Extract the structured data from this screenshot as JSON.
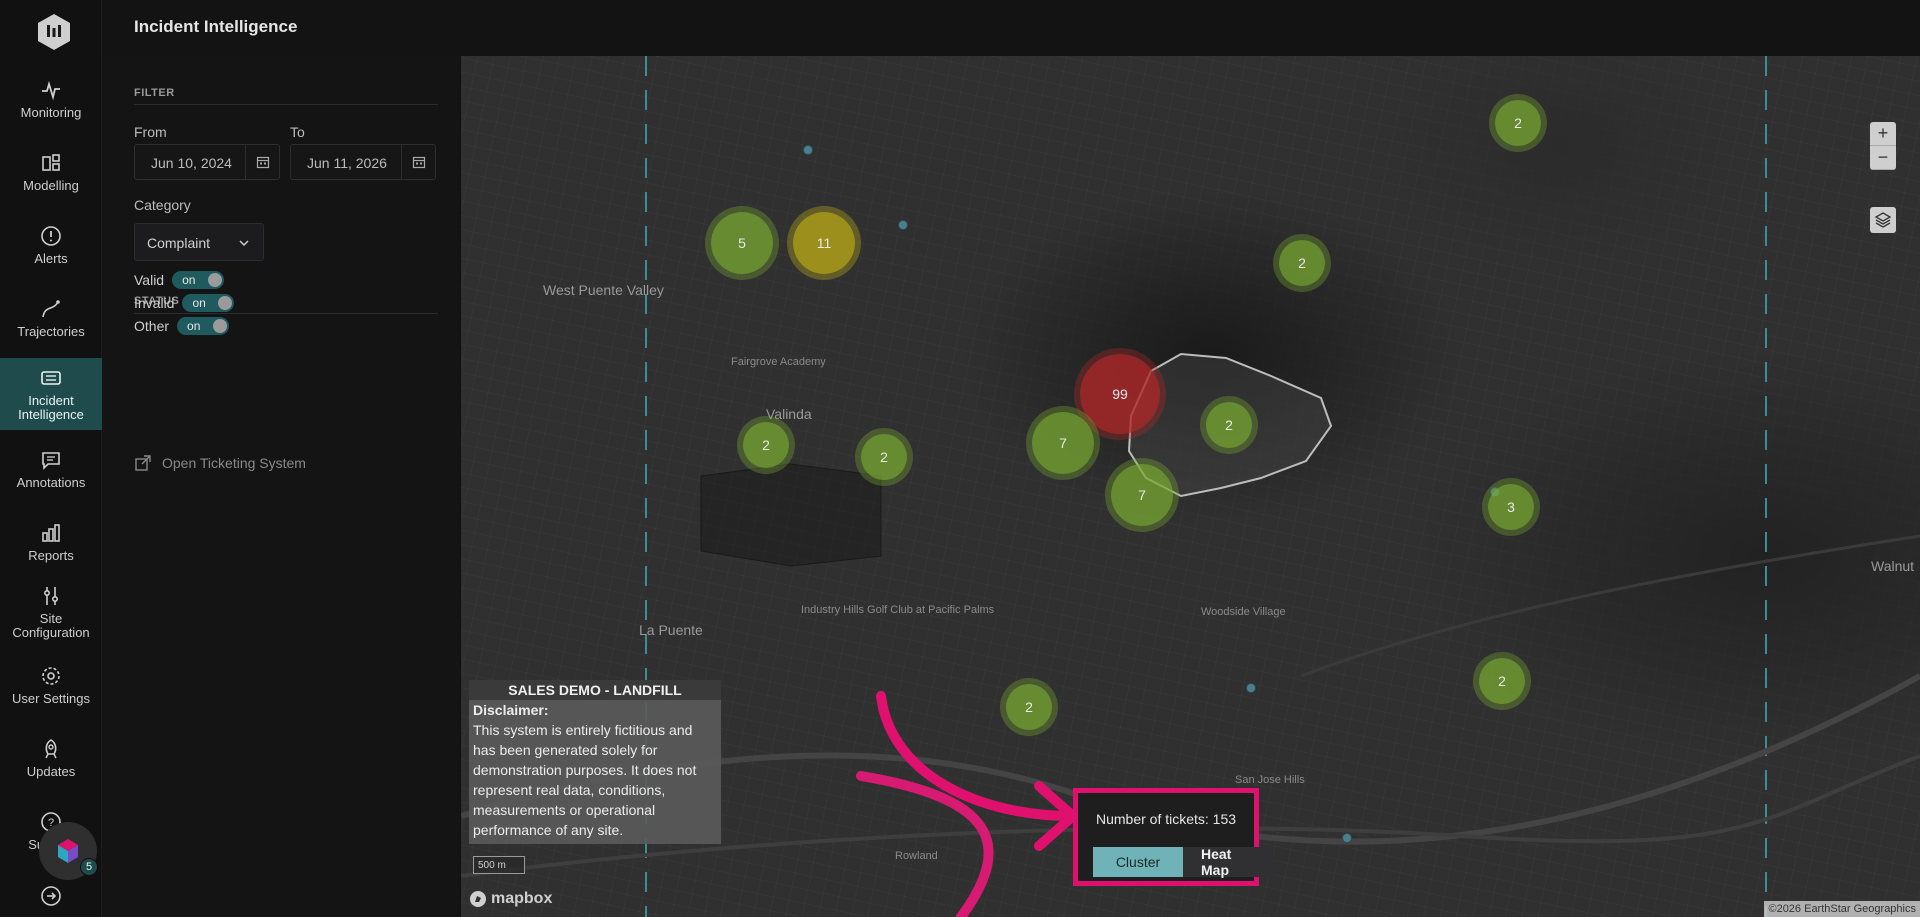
{
  "header": {
    "title": "Incident Intelligence"
  },
  "nav": {
    "items": [
      {
        "label": "Monitoring"
      },
      {
        "label": "Modelling"
      },
      {
        "label": "Alerts"
      },
      {
        "label": "Trajectories"
      },
      {
        "label": "Incident Intelligence"
      },
      {
        "label": "Annotations"
      },
      {
        "label": "Reports"
      },
      {
        "label": "Site Configuration"
      },
      {
        "label": "User Settings"
      },
      {
        "label": "Updates"
      },
      {
        "label": "Support"
      }
    ],
    "support_badge": "5"
  },
  "filter": {
    "heading": "FILTER",
    "from_label": "From",
    "from_value": "Jun 10, 2024",
    "to_label": "To",
    "to_value": "Jun 11, 2026",
    "category_label": "Category",
    "category_value": "Complaint"
  },
  "status": {
    "heading": "STATUS",
    "items": [
      {
        "label": "Valid",
        "toggle": "on"
      },
      {
        "label": "Invalid",
        "toggle": "on"
      },
      {
        "label": "Other",
        "toggle": "on"
      }
    ]
  },
  "link": {
    "open_ticketing": "Open Ticketing System"
  },
  "map": {
    "clusters": [
      "2",
      "5",
      "11",
      "2",
      "99",
      "2",
      "7",
      "2",
      "2",
      "7",
      "3",
      "2",
      "2"
    ],
    "places": [
      "West Puente Valley",
      "Valinda",
      "La Puente",
      "Woodside Village",
      "Walnut",
      "Industry Hills Golf Club at Pacific Palms",
      "Rowland",
      "San Jose Hills",
      "Fairgrove Academy"
    ],
    "disclaimer": {
      "title": "SALES DEMO - LANDFILL",
      "heading": "Disclaimer:",
      "body": "This system is entirely fictitious and has been generated solely for demonstration purposes. It does not represent real data, conditions, measurements or operational performance of any site."
    },
    "scale": "500 m",
    "brand": "mapbox",
    "attribution": "©2026 EarthStar Geographics",
    "zoom_in": "+",
    "zoom_out": "−"
  },
  "tickets": {
    "count_text": "Number of tickets: 153",
    "cluster_label": "Cluster",
    "heatmap_label": "Heat Map"
  },
  "colors": {
    "accent": "#1f4b4d",
    "highlight": "#e0116e",
    "cluster_green": "#78aa32",
    "cluster_yellow": "#afa019",
    "cluster_red": "#af2828"
  }
}
